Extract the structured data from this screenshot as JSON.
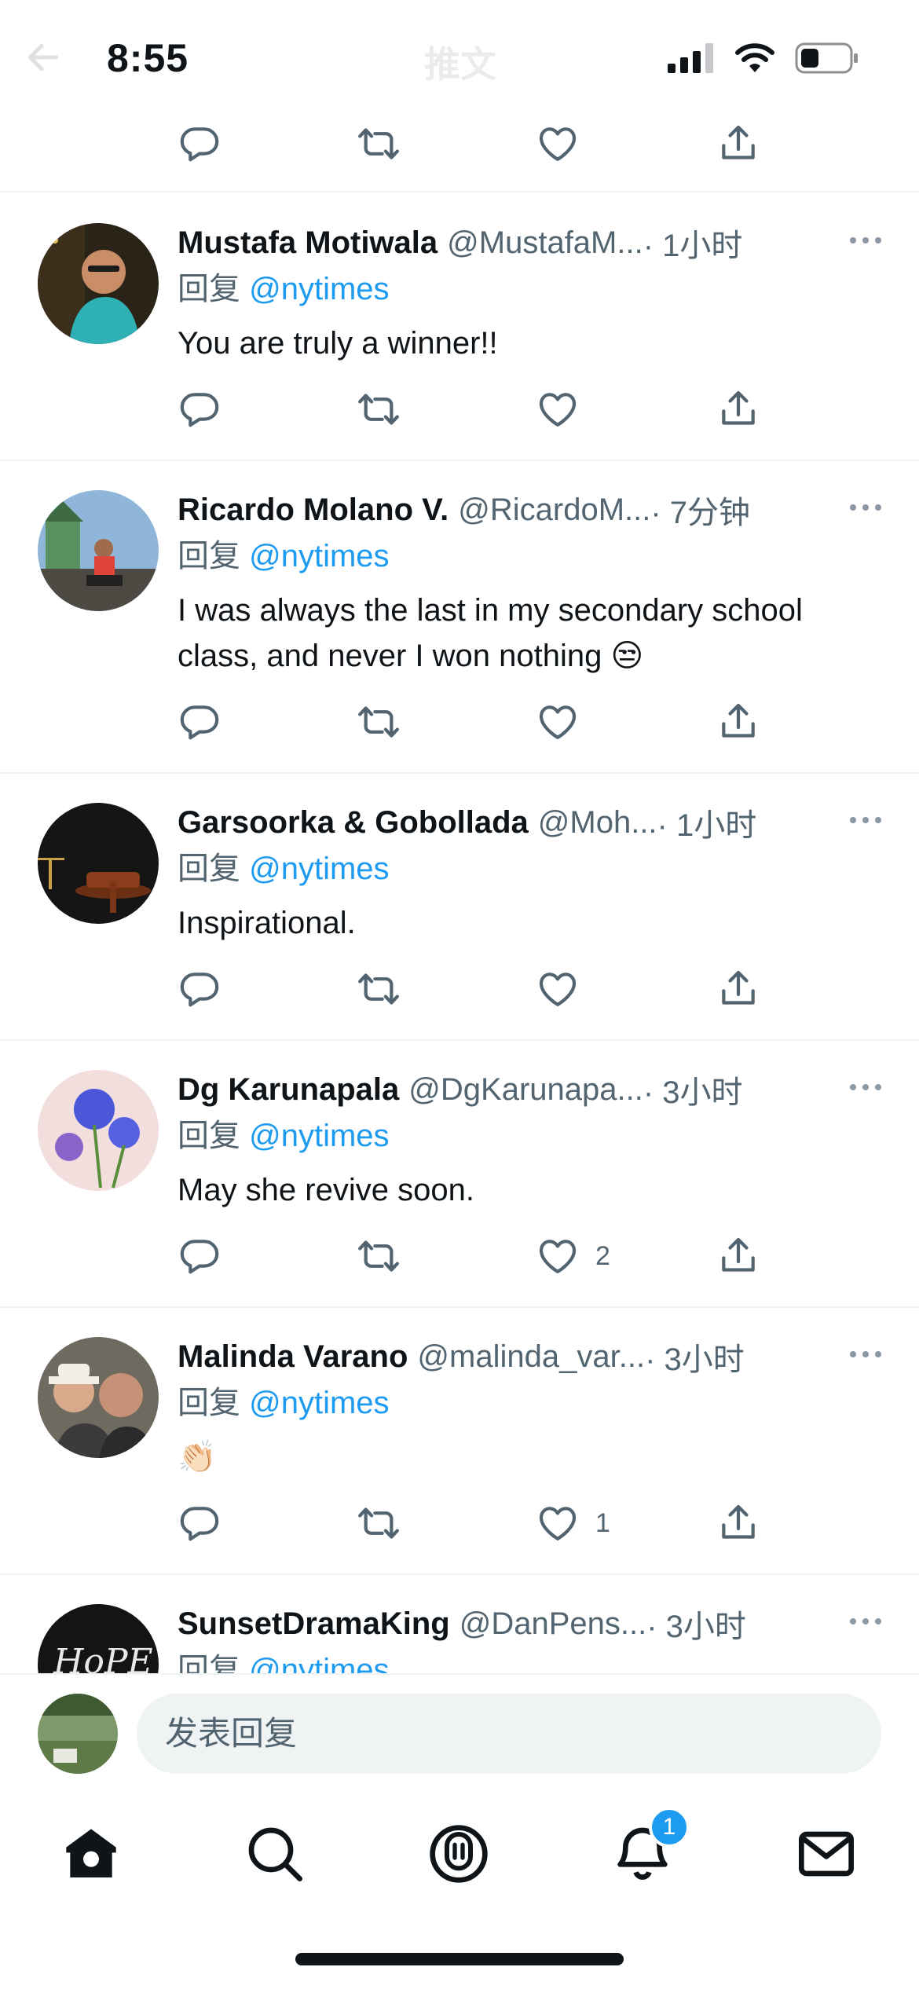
{
  "status_bar": {
    "time": "8:55",
    "ghost_title": "推文"
  },
  "tweets": [
    {
      "name": "Mustafa Motiwala",
      "handle": "@MustafaM...",
      "time": "· 1小时",
      "reply_prefix": "回复 ",
      "reply_to": "@nytimes",
      "text": "You are truly a winner!!",
      "likes": ""
    },
    {
      "name": "Ricardo Molano V.",
      "handle": "@RicardoM...",
      "time": "· 7分钟",
      "reply_prefix": "回复 ",
      "reply_to": "@nytimes",
      "text": "I was always the last in my secondary school class, and never I won nothing 😒",
      "likes": ""
    },
    {
      "name": "Garsoorka & Gobollada",
      "handle": "@Moh...",
      "time": "· 1小时",
      "reply_prefix": "回复 ",
      "reply_to": "@nytimes",
      "text": "Inspirational.",
      "likes": ""
    },
    {
      "name": "Dg Karunapala",
      "handle": "@DgKarunapa...",
      "time": "· 3小时",
      "reply_prefix": "回复 ",
      "reply_to": "@nytimes",
      "text": "May she revive soon.",
      "likes": "2"
    },
    {
      "name": "Malinda Varano",
      "handle": "@malinda_var...",
      "time": "· 3小时",
      "reply_prefix": "回复 ",
      "reply_to": "@nytimes",
      "text": "👏🏻",
      "likes": "1"
    },
    {
      "name": "SunsetDramaKing",
      "handle": "@DanPens...",
      "time": "· 3小时",
      "reply_prefix": "回复 ",
      "reply_to": "@nytimes",
      "text": "",
      "likes": ""
    }
  ],
  "composer": {
    "placeholder": "发表回复"
  },
  "tabbar": {
    "notifications_badge": "1",
    "icons": [
      "home-icon",
      "search-icon",
      "spaces-icon",
      "notifications-icon",
      "messages-icon"
    ]
  },
  "colors": {
    "accent": "#1d9bf0",
    "secondary_text": "#536471",
    "divider": "#eff3f4"
  }
}
